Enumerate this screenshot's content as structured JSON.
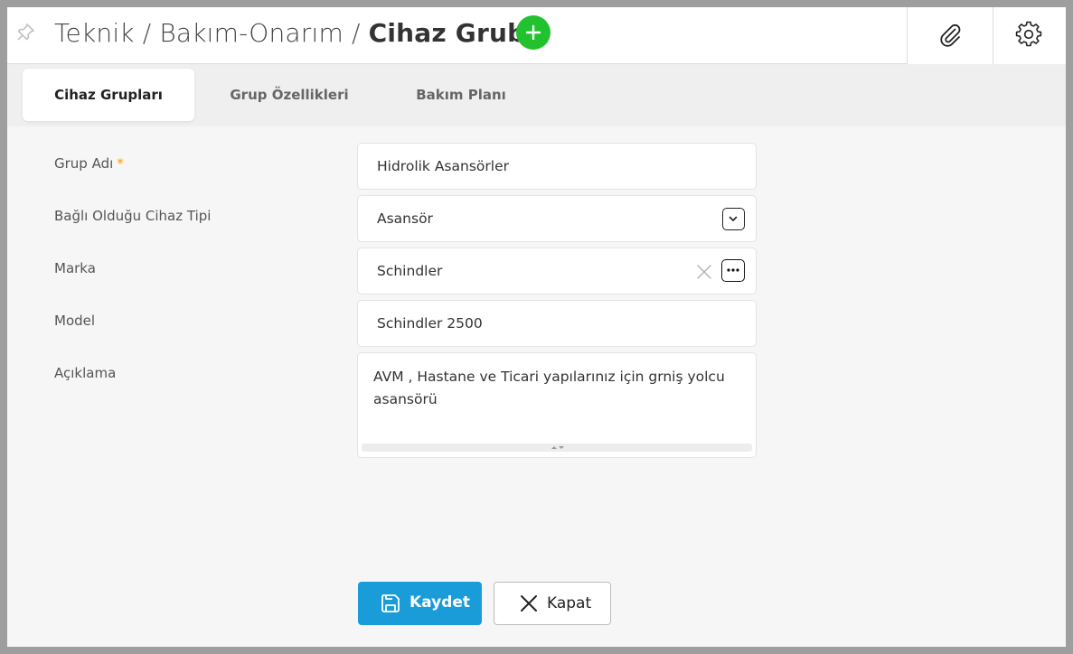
{
  "header": {
    "breadcrumb": [
      "Teknik",
      "Bakım-Onarım"
    ],
    "separator": "/",
    "current": "Cihaz Grubu",
    "pin_icon": "pin-icon",
    "add_icon": "plus-icon",
    "attach_icon": "paperclip-icon",
    "settings_icon": "gear-icon"
  },
  "tabs": [
    {
      "label": "Cihaz Grupları",
      "active": true
    },
    {
      "label": "Grup Özellikleri",
      "active": false
    },
    {
      "label": "Bakım Planı",
      "active": false
    }
  ],
  "form": {
    "group_name": {
      "label": "Grup Adı",
      "required_mark": "*",
      "value": "Hidrolik Asansörler"
    },
    "device_type": {
      "label": "Bağlı Olduğu Cihaz Tipi",
      "value": "Asansör"
    },
    "brand": {
      "label": "Marka",
      "value": "Schindler"
    },
    "model": {
      "label": "Model",
      "value": "Schindler 2500"
    },
    "description": {
      "label": "Açıklama",
      "value": "AVM , Hastane ve Ticari yapılarınız için grniş yolcu asansörü"
    }
  },
  "actions": {
    "save_label": "Kaydet",
    "close_label": "Kapat"
  },
  "colors": {
    "accent": "#1a9cd8",
    "add_button": "#22c22f",
    "required": "#f39c12"
  }
}
